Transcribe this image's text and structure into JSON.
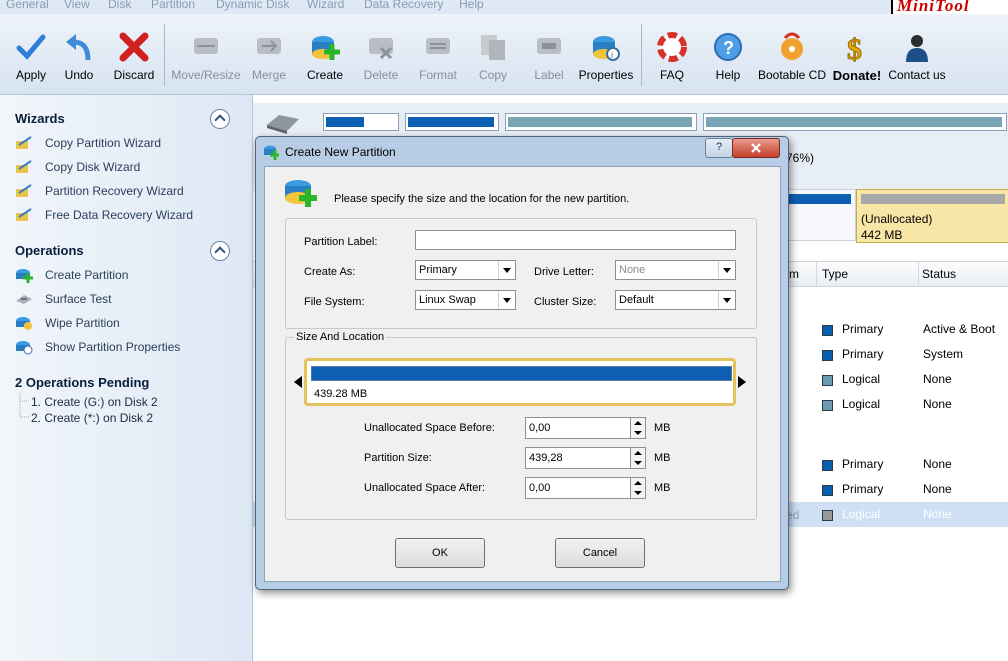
{
  "menu": [
    "General",
    "View",
    "Disk",
    "Partition",
    "Dynamic Disk",
    "Wizard",
    "Data Recovery",
    "Help"
  ],
  "brand": "MiniTool",
  "toolbar": {
    "apply": "Apply",
    "undo": "Undo",
    "discard": "Discard",
    "move_resize": "Move/Resize",
    "merge": "Merge",
    "create": "Create",
    "delete": "Delete",
    "format": "Format",
    "copy": "Copy",
    "label": "Label",
    "properties": "Properties",
    "faq": "FAQ",
    "help": "Help",
    "bootable_cd": "Bootable CD",
    "donate": "Donate!",
    "contact": "Contact us"
  },
  "sidebar": {
    "wizards_title": "Wizards",
    "wizards": [
      "Copy Partition Wizard",
      "Copy Disk Wizard",
      "Partition Recovery Wizard",
      "Free Data Recovery Wizard"
    ],
    "operations_title": "Operations",
    "operations": [
      "Create Partition",
      "Surface Test",
      "Wipe Partition",
      "Show Partition Properties"
    ],
    "pending_title": "2 Operations Pending",
    "pending": [
      "1. Create (G:) on Disk 2",
      "2. Create (*:) on Disk 2"
    ]
  },
  "main": {
    "percent": "76%)",
    "unallocated_label": "(Unallocated)",
    "unallocated_size": "442 MB",
    "col_partial": "m",
    "col_type": "Type",
    "col_status": "Status",
    "rows": [
      {
        "type": "Primary",
        "status": "Active & Boot",
        "color": "#0a5eb0"
      },
      {
        "type": "Primary",
        "status": "System",
        "color": "#0a5eb0"
      },
      {
        "type": "Logical",
        "status": "None",
        "color": "#6c9bb0"
      },
      {
        "type": "Logical",
        "status": "None",
        "color": "#6c9bb0"
      },
      {
        "type": "Primary",
        "status": "None",
        "color": "#0a5eb0"
      },
      {
        "type": "Primary",
        "status": "None",
        "color": "#0a5eb0"
      },
      {
        "type": "Logical",
        "status": "None",
        "color": "#9a9a9a",
        "partial": "ed"
      }
    ]
  },
  "dialog": {
    "title": "Create New Partition",
    "help": "?",
    "intro": "Please specify the size and the location for the new partition.",
    "partition_label": "Partition Label:",
    "partition_label_value": "",
    "create_as": "Create As:",
    "create_as_value": "Primary",
    "drive_letter": "Drive Letter:",
    "drive_letter_value": "None",
    "file_system": "File System:",
    "file_system_value": "Linux Swap",
    "cluster_size": "Cluster Size:",
    "cluster_size_value": "Default",
    "size_location": "Size And Location",
    "bar_size": "439.28 MB",
    "unalloc_before": "Unallocated Space Before:",
    "unalloc_before_value": "0,00",
    "partition_size": "Partition Size:",
    "partition_size_value": "439,28",
    "unalloc_after": "Unallocated Space After:",
    "unalloc_after_value": "0,00",
    "unit": "MB",
    "ok": "OK",
    "cancel": "Cancel"
  },
  "colors": {
    "accent": "#0d5fb3",
    "selected_row": "#cfe0f5",
    "unallocated_bg": "#f8e6a6"
  }
}
